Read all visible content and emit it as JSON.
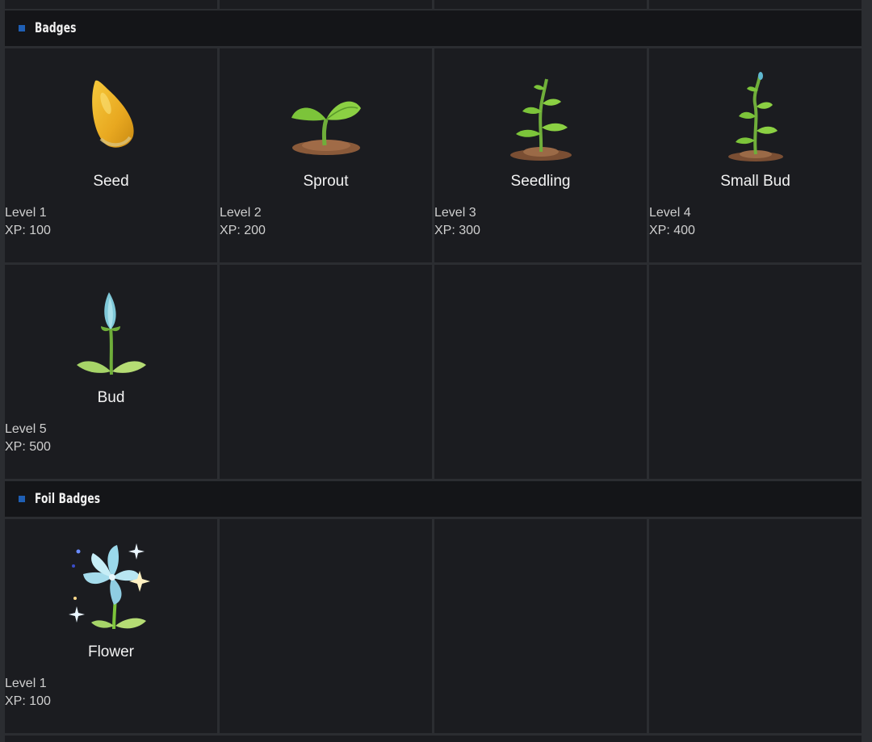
{
  "sections": [
    {
      "title": "Badges",
      "badges": [
        {
          "name": "Seed",
          "level": "Level 1",
          "xp": "XP: 100",
          "icon": "seed-icon"
        },
        {
          "name": "Sprout",
          "level": "Level 2",
          "xp": "XP: 200",
          "icon": "sprout-icon"
        },
        {
          "name": "Seedling",
          "level": "Level 3",
          "xp": "XP: 300",
          "icon": "seedling-icon"
        },
        {
          "name": "Small Bud",
          "level": "Level 4",
          "xp": "XP: 400",
          "icon": "small-bud-icon"
        },
        {
          "name": "Bud",
          "level": "Level 5",
          "xp": "XP: 500",
          "icon": "bud-icon"
        }
      ]
    },
    {
      "title": "Foil Badges",
      "badges": [
        {
          "name": "Flower",
          "level": "Level 1",
          "xp": "XP: 100",
          "icon": "sparkling-flower-icon"
        }
      ]
    }
  ],
  "colors": {
    "accent": "#1f5fb4",
    "cell_bg": "#1b1c20",
    "header_bg": "#141518",
    "page_bg": "#2b2d31"
  }
}
